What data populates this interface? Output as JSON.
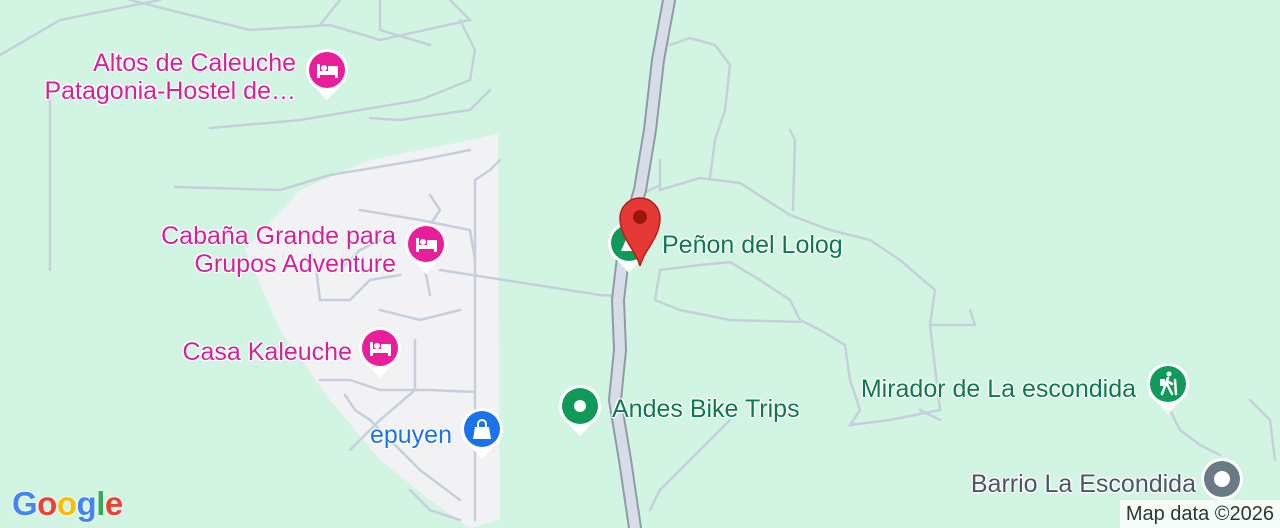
{
  "map": {
    "pois": [
      {
        "id": "altos",
        "name_lines": [
          "Altos de Caleuche",
          "Patagonia-Hostel de…"
        ],
        "category": "hotel-icon",
        "color": "#e91e9b"
      },
      {
        "id": "cabana",
        "name_lines": [
          "Cabaña Grande para",
          "Grupos Adventure"
        ],
        "category": "hotel-icon",
        "color": "#e91e9b"
      },
      {
        "id": "casa",
        "name_lines": [
          "Casa Kaleuche"
        ],
        "category": "hotel-icon",
        "color": "#e91e9b"
      },
      {
        "id": "epuyen",
        "name_lines": [
          "epuyen"
        ],
        "category": "shopping-bag-icon",
        "color": "#1a73e8"
      },
      {
        "id": "penon",
        "name_lines": [
          "Peñon del Lolog"
        ],
        "category": "park-icon",
        "color": "#109a5a"
      },
      {
        "id": "andes",
        "name_lines": [
          "Andes Bike Trips"
        ],
        "category": "place-dot-icon",
        "color": "#109a5a"
      },
      {
        "id": "mirador",
        "name_lines": [
          "Mirador de La escondida"
        ],
        "category": "hiking-icon",
        "color": "#109a5a"
      },
      {
        "id": "barrio",
        "name_lines": [
          "Barrio La Escondida"
        ],
        "category": "neighborhood-icon",
        "color": "#6b7b86"
      }
    ],
    "selected_marker": {
      "color": "#e53935",
      "icon": "location-pin-icon"
    },
    "attribution": "Map data ©2026",
    "logo": {
      "letters": [
        "G",
        "o",
        "o",
        "g",
        "l",
        "e"
      ],
      "colors": [
        "#4285f4",
        "#ea4335",
        "#fbbc05",
        "#4285f4",
        "#34a853",
        "#ea4335"
      ]
    }
  }
}
